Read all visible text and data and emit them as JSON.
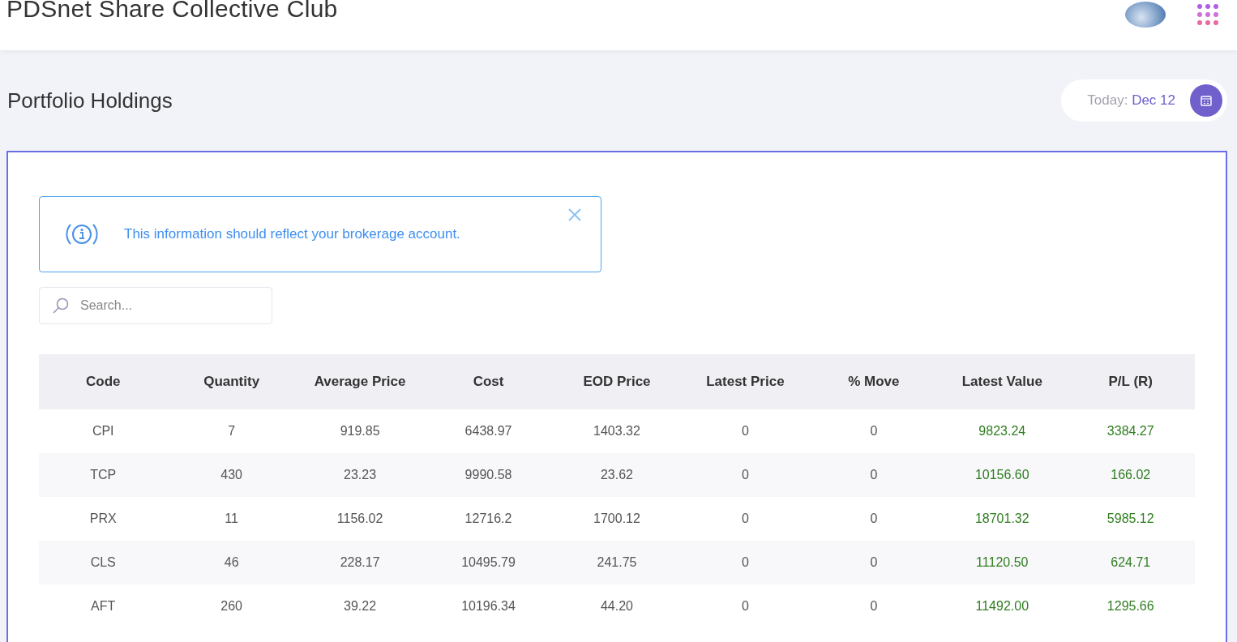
{
  "app_title": "PDSnet Share Collective Club",
  "page_title": "Portfolio Holdings",
  "date_pill": {
    "label": "Today:",
    "value": "Dec 12"
  },
  "alert": {
    "message": "This information should reflect your brokerage account."
  },
  "search": {
    "placeholder": "Search..."
  },
  "table": {
    "columns": [
      {
        "label": "Code",
        "kind": "plain"
      },
      {
        "label": "Quantity",
        "kind": "plain"
      },
      {
        "label": "Average Price",
        "kind": "plain"
      },
      {
        "label": "Cost",
        "kind": "plain"
      },
      {
        "label": "EOD Price",
        "kind": "plain"
      },
      {
        "label": "Latest Price",
        "kind": "plain"
      },
      {
        "label": "% Move",
        "kind": "plain"
      },
      {
        "label": "Latest Value",
        "kind": "gain"
      },
      {
        "label": "P/L (R)",
        "kind": "gain"
      }
    ],
    "rows": [
      [
        "CPI",
        "7",
        "919.85",
        "6438.97",
        "1403.32",
        "0",
        "0",
        "9823.24",
        "3384.27"
      ],
      [
        "TCP",
        "430",
        "23.23",
        "9990.58",
        "23.62",
        "0",
        "0",
        "10156.60",
        "166.02"
      ],
      [
        "PRX",
        "11",
        "1156.02",
        "12716.2",
        "1700.12",
        "0",
        "0",
        "18701.32",
        "5985.12"
      ],
      [
        "CLS",
        "46",
        "228.17",
        "10495.79",
        "241.75",
        "0",
        "0",
        "11120.50",
        "624.71"
      ],
      [
        "AFT",
        "260",
        "39.22",
        "10196.34",
        "44.20",
        "0",
        "0",
        "11492.00",
        "1295.66"
      ]
    ]
  }
}
